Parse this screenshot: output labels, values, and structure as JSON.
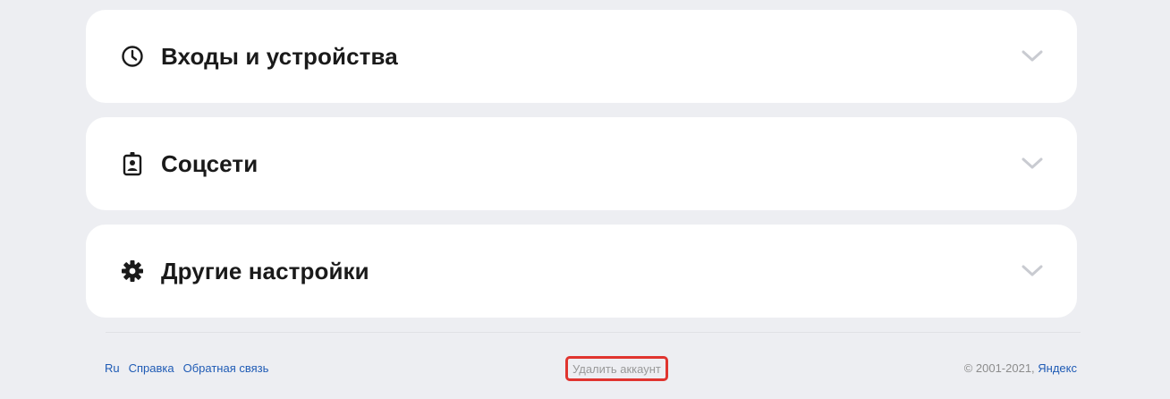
{
  "sections": [
    {
      "title": "Входы и устройства",
      "icon": "clock-icon"
    },
    {
      "title": "Соцсети",
      "icon": "badge-icon"
    },
    {
      "title": "Другие настройки",
      "icon": "gear-icon"
    }
  ],
  "footer": {
    "links": [
      "Ru",
      "Справка",
      "Обратная связь"
    ],
    "delete_account": "Удалить аккаунт",
    "copyright": "© 2001-2021, ",
    "brand": "Яндекс"
  },
  "colors": {
    "background": "#edeef2",
    "card": "#ffffff",
    "link": "#1f5bb5",
    "highlight": "#e0342f"
  }
}
